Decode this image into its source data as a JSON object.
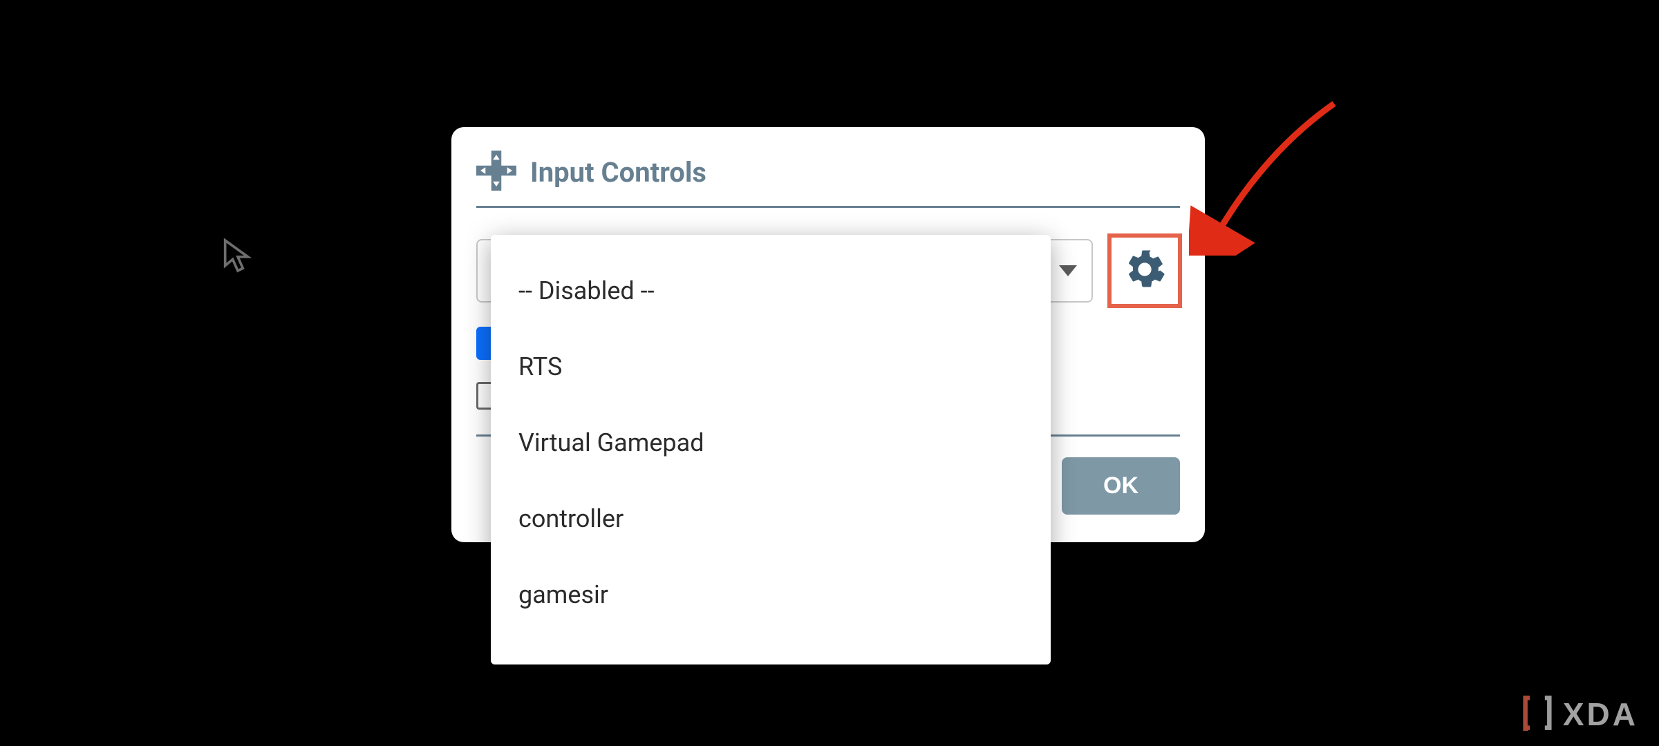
{
  "colors": {
    "card_accent": "#678091",
    "ok_button": "#7e98a6",
    "highlight": "#e4634a"
  },
  "card": {
    "title": "Input Controls",
    "header_icon": "dpad-icon",
    "select": {
      "selected_label": "-- Disabled --"
    },
    "ok_label": "OK"
  },
  "dropdown": {
    "items": [
      {
        "label": "-- Disabled --"
      },
      {
        "label": "RTS"
      },
      {
        "label": "Virtual Gamepad"
      },
      {
        "label": "controller"
      },
      {
        "label": "gamesir"
      }
    ]
  },
  "watermark": {
    "text": "XDA"
  }
}
